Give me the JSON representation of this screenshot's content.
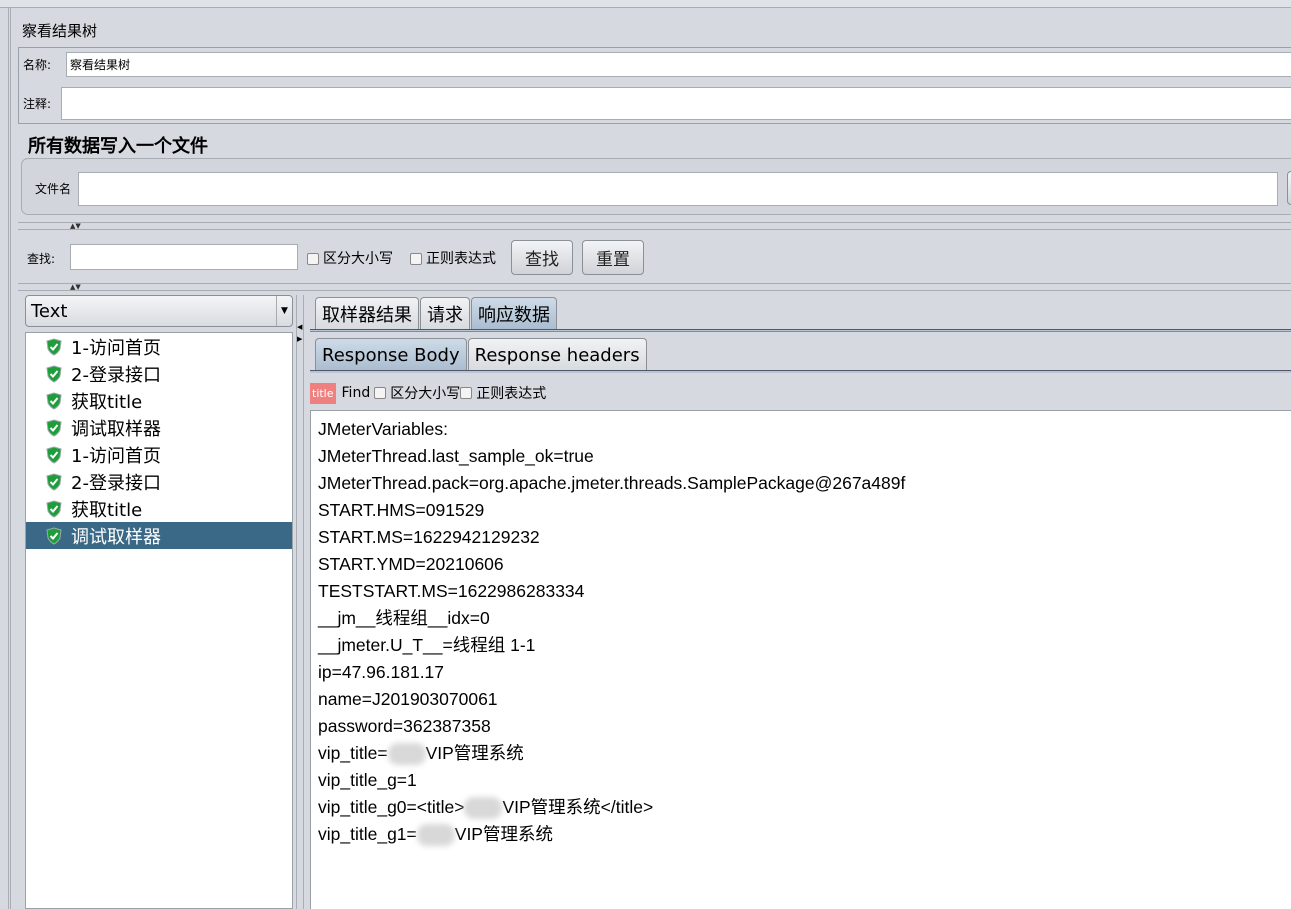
{
  "panel": {
    "title": "察看结果树",
    "name_label": "名称:",
    "name_value": "察看结果树",
    "comment_label": "注释:",
    "comment_value": ""
  },
  "file": {
    "section_title": "所有数据写入一个文件",
    "filename_label": "文件名",
    "filename_value": ""
  },
  "search": {
    "label": "查找:",
    "value": "",
    "case_label": "区分大小写",
    "regex_label": "正则表达式",
    "find_button": "查找",
    "reset_button": "重置"
  },
  "renderer": {
    "selected": "Text"
  },
  "tree": {
    "items": [
      {
        "label": "1-访问首页",
        "status": "success"
      },
      {
        "label": "2-登录接口",
        "status": "success"
      },
      {
        "label": "获取title",
        "status": "success"
      },
      {
        "label": "调试取样器",
        "status": "success"
      },
      {
        "label": "1-访问首页",
        "status": "success"
      },
      {
        "label": "2-登录接口",
        "status": "success"
      },
      {
        "label": "获取title",
        "status": "success"
      },
      {
        "label": "调试取样器",
        "status": "success",
        "selected": true
      }
    ]
  },
  "tabs": [
    {
      "label": "取样器结果"
    },
    {
      "label": "请求"
    },
    {
      "label": "响应数据",
      "active": true
    }
  ],
  "subtabs": [
    {
      "label": "Response Body",
      "active": true
    },
    {
      "label": "Response headers"
    }
  ],
  "findbar": {
    "badge": "title",
    "find_label": "Find",
    "case_label": "区分大小写",
    "regex_label": "正则表达式",
    "badge_color": "#f08080"
  },
  "body_lines": [
    "JMeterVariables:",
    "JMeterThread.last_sample_ok=true",
    "JMeterThread.pack=org.apache.jmeter.threads.SamplePackage@267a489f",
    "START.HMS=091529",
    "START.MS=1622942129232",
    "START.YMD=20210606",
    "TESTSTART.MS=1622986283334",
    "__jm__线程组__idx=0",
    "__jmeter.U_T__=线程组 1-1",
    "ip=47.96.181.17",
    "name=J201903070061",
    "password=362387358"
  ],
  "blurred_lines": [
    {
      "prefix": "vip_title=",
      "suffix": "VIP管理系统"
    },
    {
      "prefix": "vip_title_g=1",
      "suffix": ""
    },
    {
      "prefix": "vip_title_g0=<title>",
      "suffix": "VIP管理系统</title>"
    },
    {
      "prefix": "vip_title_g1=",
      "suffix": "VIP管理系统"
    }
  ],
  "colors": {
    "selection": "#3a6887",
    "success_icon": "#1e9e3a"
  }
}
